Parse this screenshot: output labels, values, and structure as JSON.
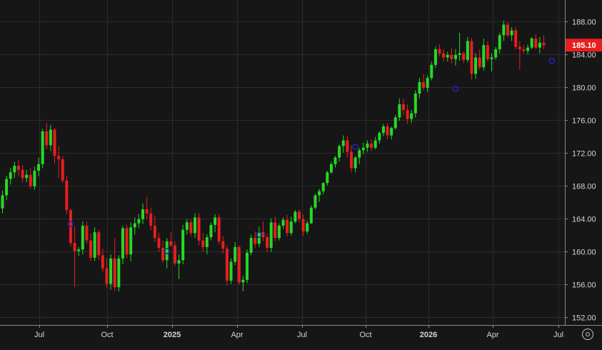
{
  "chart_data": {
    "type": "candlestick",
    "x_tick_labels": [
      "Jul",
      "Oct",
      "2025",
      "Apr",
      "Jul",
      "Oct",
      "2026",
      "Apr",
      "Jul"
    ],
    "y_ticks": [
      152,
      156,
      160,
      164,
      168,
      172,
      176,
      180,
      184,
      188
    ],
    "y_tick_labels": [
      "152.00",
      "156.00",
      "160.00",
      "164.00",
      "168.00",
      "172.00",
      "176.00",
      "180.00",
      "184.00",
      "188.00"
    ],
    "ylim": [
      151.0,
      190.6
    ],
    "last_price": 185.1,
    "last_price_label": "185.10",
    "grid": true,
    "colors": {
      "up": "#26d926",
      "down": "#e81e1e",
      "price_tag": "#e81e1e",
      "marker": "#2222aa"
    },
    "candles": [
      [
        165.2,
        167.4,
        164.6,
        166.8
      ],
      [
        166.8,
        169.2,
        166.2,
        168.8
      ],
      [
        168.8,
        170.1,
        168.1,
        169.6
      ],
      [
        169.6,
        170.9,
        168.9,
        170.4
      ],
      [
        170.4,
        171.1,
        169.1,
        169.9
      ],
      [
        169.9,
        170.5,
        168.4,
        168.9
      ],
      [
        168.9,
        169.9,
        168.4,
        169.3
      ],
      [
        169.3,
        170.1,
        167.6,
        167.9
      ],
      [
        167.9,
        170.3,
        167.5,
        169.8
      ],
      [
        169.8,
        171.4,
        169.1,
        170.6
      ],
      [
        170.6,
        174.9,
        170.1,
        174.6
      ],
      [
        174.6,
        175.6,
        172.4,
        172.9
      ],
      [
        172.9,
        175.4,
        172.2,
        174.8
      ],
      [
        174.8,
        175.0,
        170.7,
        171.6
      ],
      [
        171.6,
        172.8,
        168.9,
        171.2
      ],
      [
        171.2,
        171.6,
        168.3,
        168.6
      ],
      [
        168.6,
        169.2,
        164.5,
        165.0
      ],
      [
        165.0,
        165.2,
        160.6,
        161.0
      ],
      [
        161.0,
        163.0,
        155.6,
        160.0
      ],
      [
        160.0,
        160.5,
        159.4,
        160.2
      ],
      [
        160.2,
        163.6,
        159.6,
        163.1
      ],
      [
        163.1,
        163.6,
        160.9,
        161.3
      ],
      [
        161.3,
        162.1,
        158.8,
        159.2
      ],
      [
        159.2,
        162.9,
        158.8,
        162.3
      ],
      [
        162.3,
        162.6,
        158.9,
        159.5
      ],
      [
        159.5,
        160.3,
        157.4,
        157.9
      ],
      [
        157.9,
        159.1,
        155.5,
        156.0
      ],
      [
        156.0,
        159.6,
        155.3,
        159.1
      ],
      [
        159.1,
        161.6,
        155.1,
        155.6
      ],
      [
        155.6,
        159.5,
        155.1,
        159.1
      ],
      [
        159.1,
        163.1,
        158.4,
        162.8
      ],
      [
        162.8,
        163.2,
        159.1,
        159.6
      ],
      [
        159.6,
        163.5,
        158.8,
        162.9
      ],
      [
        162.9,
        164.1,
        162.0,
        163.4
      ],
      [
        163.4,
        164.5,
        162.8,
        163.9
      ],
      [
        163.9,
        165.8,
        163.3,
        165.1
      ],
      [
        165.1,
        166.6,
        163.9,
        164.6
      ],
      [
        164.6,
        165.3,
        162.6,
        163.1
      ],
      [
        163.1,
        164.3,
        161.1,
        161.6
      ],
      [
        161.6,
        162.2,
        159.9,
        160.4
      ],
      [
        160.4,
        161.3,
        158.6,
        158.9
      ],
      [
        158.9,
        161.6,
        157.9,
        161.2
      ],
      [
        161.2,
        162.3,
        160.5,
        160.7
      ],
      [
        160.7,
        161.2,
        158.2,
        158.5
      ],
      [
        158.5,
        159.6,
        156.6,
        158.9
      ],
      [
        158.9,
        163.2,
        158.4,
        162.6
      ],
      [
        162.6,
        163.9,
        162.0,
        163.5
      ],
      [
        163.5,
        163.9,
        161.8,
        162.2
      ],
      [
        162.2,
        164.6,
        161.6,
        164.1
      ],
      [
        164.1,
        164.6,
        160.7,
        161.3
      ],
      [
        161.3,
        162.2,
        159.9,
        160.5
      ],
      [
        160.5,
        162.1,
        159.6,
        161.7
      ],
      [
        161.7,
        163.5,
        161.3,
        163.2
      ],
      [
        163.2,
        164.5,
        162.3,
        164.1
      ],
      [
        164.1,
        164.5,
        160.8,
        161.2
      ],
      [
        161.2,
        161.8,
        159.7,
        160.3
      ],
      [
        160.3,
        160.7,
        155.8,
        156.4
      ],
      [
        156.4,
        159.1,
        156.0,
        158.7
      ],
      [
        158.7,
        161.1,
        158.3,
        160.5
      ],
      [
        160.5,
        160.7,
        155.9,
        156.2
      ],
      [
        156.2,
        157.0,
        155.1,
        156.5
      ],
      [
        156.5,
        160.2,
        156.1,
        159.8
      ],
      [
        159.8,
        162.0,
        159.5,
        161.6
      ],
      [
        161.6,
        162.4,
        160.4,
        160.9
      ],
      [
        160.9,
        163.0,
        160.5,
        162.3
      ],
      [
        162.3,
        163.6,
        161.2,
        161.7
      ],
      [
        161.7,
        162.1,
        159.8,
        160.4
      ],
      [
        160.4,
        164.0,
        159.9,
        163.5
      ],
      [
        163.5,
        164.2,
        161.2,
        161.6
      ],
      [
        161.6,
        163.4,
        161.3,
        163.1
      ],
      [
        163.1,
        164.1,
        162.7,
        163.8
      ],
      [
        163.8,
        164.4,
        161.8,
        162.2
      ],
      [
        162.2,
        164.2,
        161.9,
        163.6
      ],
      [
        163.6,
        165.0,
        163.4,
        164.8
      ],
      [
        164.8,
        165.1,
        163.5,
        163.9
      ],
      [
        163.9,
        164.5,
        161.8,
        162.4
      ],
      [
        162.4,
        163.7,
        162.1,
        163.4
      ],
      [
        163.4,
        165.6,
        163.3,
        165.3
      ],
      [
        165.3,
        167.0,
        165.1,
        166.8
      ],
      [
        166.8,
        167.6,
        166.0,
        167.3
      ],
      [
        167.3,
        168.4,
        166.9,
        168.3
      ],
      [
        168.3,
        169.8,
        168.0,
        169.6
      ],
      [
        169.6,
        170.9,
        169.4,
        170.6
      ],
      [
        170.6,
        171.6,
        170.2,
        171.4
      ],
      [
        171.4,
        173.0,
        170.9,
        172.8
      ],
      [
        172.8,
        174.1,
        172.0,
        173.5
      ],
      [
        173.5,
        174.0,
        171.4,
        172.1
      ],
      [
        172.1,
        172.9,
        169.6,
        170.1
      ],
      [
        170.1,
        171.6,
        169.6,
        171.4
      ],
      [
        171.4,
        172.6,
        170.6,
        172.3
      ],
      [
        172.3,
        173.2,
        171.8,
        172.6
      ],
      [
        172.6,
        173.5,
        172.1,
        173.1
      ],
      [
        173.1,
        173.6,
        172.2,
        172.6
      ],
      [
        172.6,
        173.9,
        172.4,
        173.5
      ],
      [
        173.5,
        174.6,
        173.1,
        174.4
      ],
      [
        174.4,
        175.5,
        174.0,
        175.2
      ],
      [
        175.2,
        175.6,
        173.6,
        174.1
      ],
      [
        174.1,
        175.2,
        173.6,
        175.0
      ],
      [
        175.0,
        176.6,
        174.8,
        176.3
      ],
      [
        176.3,
        178.6,
        175.9,
        177.9
      ],
      [
        177.9,
        178.6,
        176.6,
        177.2
      ],
      [
        177.2,
        177.9,
        175.5,
        176.1
      ],
      [
        176.1,
        177.2,
        175.6,
        176.8
      ],
      [
        176.8,
        179.6,
        176.3,
        179.2
      ],
      [
        179.2,
        181.1,
        178.6,
        180.6
      ],
      [
        180.6,
        181.6,
        179.6,
        179.9
      ],
      [
        179.9,
        181.4,
        179.4,
        181.1
      ],
      [
        181.1,
        183.1,
        180.8,
        182.7
      ],
      [
        182.7,
        184.9,
        182.3,
        184.6
      ],
      [
        184.6,
        185.2,
        183.7,
        184.1
      ],
      [
        184.1,
        184.6,
        183.1,
        183.6
      ],
      [
        183.6,
        184.3,
        183.1,
        183.9
      ],
      [
        183.9,
        184.7,
        182.9,
        183.4
      ],
      [
        183.4,
        184.6,
        182.6,
        183.9
      ],
      [
        183.9,
        186.6,
        183.2,
        184.1
      ],
      [
        184.1,
        184.3,
        182.9,
        183.3
      ],
      [
        183.3,
        186.1,
        183.0,
        185.6
      ],
      [
        185.6,
        186.0,
        180.9,
        181.6
      ],
      [
        181.6,
        184.1,
        181.0,
        183.6
      ],
      [
        183.6,
        184.6,
        182.1,
        182.4
      ],
      [
        182.4,
        185.9,
        182.0,
        185.1
      ],
      [
        185.1,
        185.6,
        183.1,
        183.4
      ],
      [
        183.4,
        184.1,
        181.9,
        183.6
      ],
      [
        183.6,
        184.9,
        183.3,
        184.6
      ],
      [
        184.6,
        186.6,
        184.1,
        186.3
      ],
      [
        186.3,
        188.1,
        185.6,
        187.6
      ],
      [
        187.6,
        187.9,
        186.1,
        186.3
      ],
      [
        186.3,
        187.3,
        185.6,
        186.9
      ],
      [
        186.9,
        187.3,
        184.6,
        184.9
      ],
      [
        184.9,
        185.6,
        182.1,
        184.6
      ],
      [
        184.6,
        185.1,
        184.1,
        184.4
      ],
      [
        184.4,
        185.2,
        184.0,
        184.8
      ],
      [
        184.8,
        186.1,
        184.6,
        185.9
      ],
      [
        185.9,
        186.4,
        184.6,
        184.8
      ],
      [
        184.8,
        186.1,
        184.1,
        185.4
      ],
      [
        185.4,
        186.3,
        184.6,
        185.1
      ]
    ],
    "markers": [
      {
        "index": 17,
        "value": 163.3
      },
      {
        "index": 41,
        "value": 160.0
      },
      {
        "index": 64,
        "value": 162.0
      },
      {
        "index": 88,
        "value": 172.7
      },
      {
        "index": 113,
        "value": 179.8
      },
      {
        "index": 137,
        "value": 183.2
      }
    ]
  }
}
